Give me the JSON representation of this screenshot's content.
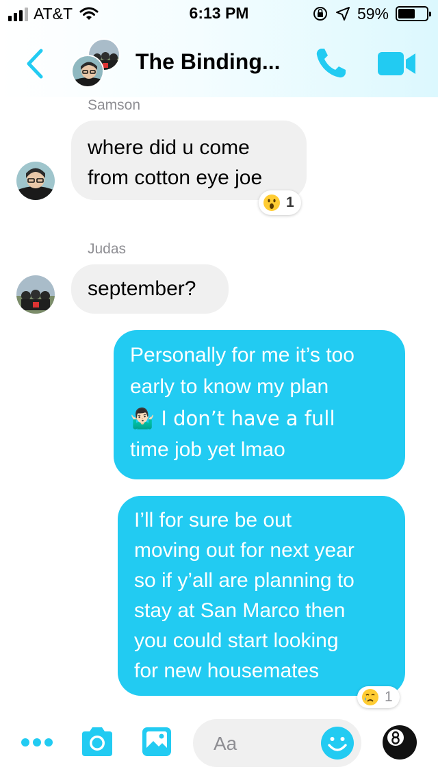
{
  "status_bar": {
    "carrier": "AT&T",
    "time": "6:13 PM",
    "battery_percent": "59%",
    "battery_level": 0.59
  },
  "header": {
    "title": "The Binding...",
    "back_icon": "chevron-left-icon",
    "call_icon": "phone-icon",
    "video_icon": "video-camera-icon"
  },
  "messages": [
    {
      "sender": "Samson",
      "direction": "incoming",
      "lines": [
        "where did u come",
        "from cotton eye joe"
      ],
      "reaction": {
        "emoji": "surprised-face-icon",
        "count": "1"
      }
    },
    {
      "sender": "Judas",
      "direction": "incoming",
      "lines": [
        "september?"
      ]
    },
    {
      "direction": "outgoing",
      "lines": [
        "Personally for me it’s too",
        "early to know my plan",
        "🤷🏻‍♂️ I don’t have a full",
        "time job yet lmao"
      ]
    },
    {
      "direction": "outgoing",
      "lines": [
        "I’ll for sure be out",
        "moving out for next year",
        "so if y’all are planning to",
        "stay at San Marco then",
        "you could start looking",
        "for new housemates"
      ],
      "reaction": {
        "emoji": "crying-face-icon",
        "count": "1"
      }
    }
  ],
  "composer": {
    "placeholder": "Aa"
  },
  "colors": {
    "accent": "#22cbf2",
    "incoming_bubble": "#f0f0f0",
    "secondary_text": "#8e8e93"
  }
}
